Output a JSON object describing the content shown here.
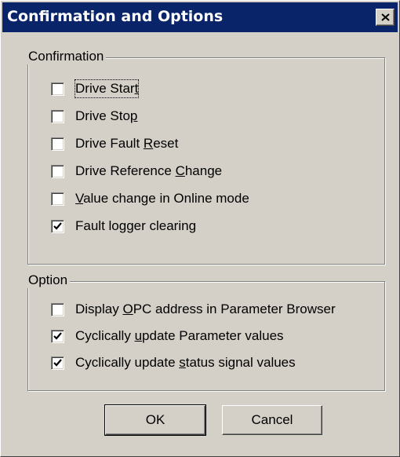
{
  "window": {
    "title": "Confirmation and Options",
    "close_glyph": "close-icon"
  },
  "confirmation": {
    "label": "Confirmation",
    "items": [
      {
        "pre": "Drive Star",
        "u": "t",
        "post": "",
        "checked": false
      },
      {
        "pre": "Drive Sto",
        "u": "p",
        "post": "",
        "checked": false
      },
      {
        "pre": "Drive Fault ",
        "u": "R",
        "post": "eset",
        "checked": false
      },
      {
        "pre": "Drive Reference ",
        "u": "C",
        "post": "hange",
        "checked": false
      },
      {
        "pre": "",
        "u": "V",
        "post": "alue change in Online mode",
        "checked": false
      },
      {
        "pre": "Fault logger clearing",
        "u": "",
        "post": "",
        "checked": true
      }
    ]
  },
  "option": {
    "label": "Option",
    "items": [
      {
        "pre": "Display ",
        "u": "O",
        "post": "PC address in Parameter Browser",
        "checked": false
      },
      {
        "pre": "Cyclically ",
        "u": "u",
        "post": "pdate Parameter values",
        "checked": true
      },
      {
        "pre": "Cyclically update ",
        "u": "s",
        "post": "tatus signal values",
        "checked": true
      }
    ]
  },
  "buttons": {
    "ok": "OK",
    "cancel": "Cancel"
  },
  "colors": {
    "titlebar": "#0a246a",
    "face": "#d4d0c8"
  }
}
